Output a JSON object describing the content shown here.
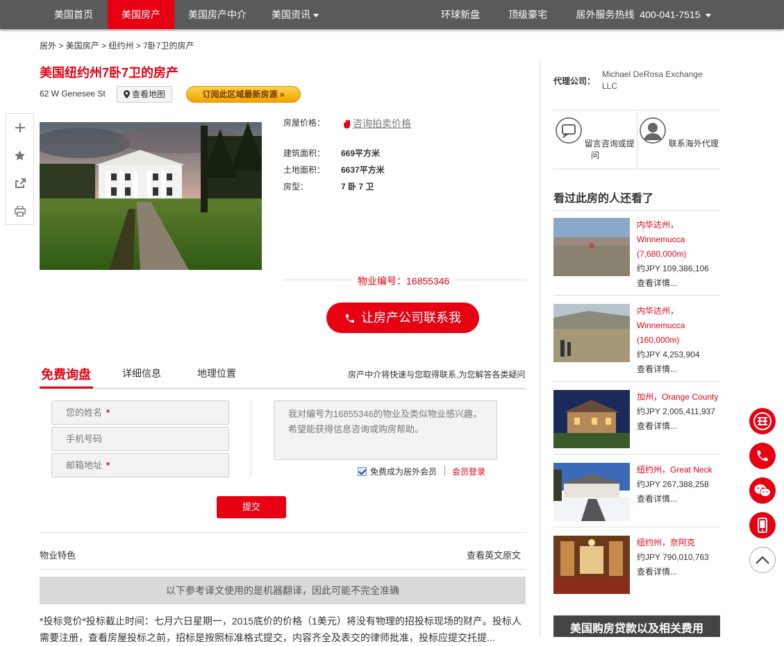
{
  "nav": {
    "items": [
      {
        "label": "美国首页",
        "active": false
      },
      {
        "label": "美国房产",
        "active": true
      },
      {
        "label": "美国房产中介",
        "active": false
      },
      {
        "label": "美国资讯",
        "active": false
      }
    ],
    "right": [
      "环球新盘",
      "顶级豪宅"
    ],
    "hotline_label": "居外服务热线",
    "hotline_number": "400-041-7515"
  },
  "breadcrumb": [
    "居外",
    "美国房产",
    "纽约州",
    "7卧7卫的房产"
  ],
  "breadcrumb_sep": " > ",
  "listing": {
    "title": "美国纽约州7卧7卫的房产",
    "address": "62 W Genesee St",
    "map_button": "查看地图",
    "subscribe_button": "订阅此区域最新房源",
    "price_label": "房屋价格：",
    "price_link": "咨询拍卖价格",
    "floor_area_label": "建筑面积：",
    "floor_area": "669平方米",
    "land_area_label": "土地面积：",
    "land_area": "6637平方米",
    "type_label": "房型：",
    "type": "7 卧 7 卫",
    "listing_id_label": "物业编号：",
    "listing_id": "16855346",
    "contact_button": "让房产公司联系我"
  },
  "tabs": {
    "items": [
      "免费询盘",
      "详细信息",
      "地理位置"
    ],
    "note": "房产中介将快速与您取得联系,为您解答各类疑问"
  },
  "form": {
    "name_placeholder": "您的姓名",
    "phone_placeholder": "手机号码",
    "email_placeholder": "邮箱地址",
    "required_mark": "*",
    "message": "我对编号为16855346的物业及类似物业感兴趣，希望能获得信息咨询或购房帮助。",
    "member_checkbox": "免费成为居外会员",
    "member_login": "会员登录",
    "submit": "提交"
  },
  "features": {
    "label": "物业特色",
    "original_link": "查看英文原文",
    "machine_notice": "以下参考译文使用的是机器翻译，因此可能不完全准确",
    "description": "*投标竞价*投标截止时间：七月六日星期一，2015底价的价格（1美元）将没有物理的招投标现场的财产。投标人需要注册，查看房屋投标之前，招标是按照标准格式提交，内容齐全及表交的律师批准，投标应提交托提..."
  },
  "agent": {
    "label": "代理公司：",
    "name": "Michael DeRosa Exchange LLC",
    "consult_label": "留言咨询或提问",
    "contact_label": "联系海外代理"
  },
  "also_viewed": {
    "title": "看过此房的人还看了",
    "items": [
      {
        "location": "内华达州，Winnemucca (7,680,000m)",
        "price": "约JPY 109,386,106",
        "more": "查看详情..."
      },
      {
        "location": "内华达州，Winnemucca (160,000m)",
        "price": "约JPY 4,253,904",
        "more": "查看详情..."
      },
      {
        "location": "加州，Orange County",
        "price": "约JPY 2,005,411,937",
        "more": "查看详情..."
      },
      {
        "location": "纽约州，Great Neck",
        "price": "约JPY 267,388,258",
        "more": "查看详情..."
      },
      {
        "location": "纽约州，奈阿克",
        "price": "约JPY 790,010,763",
        "more": "查看详情..."
      }
    ]
  },
  "loan_box": "美国购房贷款以及相关费用",
  "colors": {
    "accent": "#e60012",
    "nav_bg": "#5a5a5a"
  }
}
